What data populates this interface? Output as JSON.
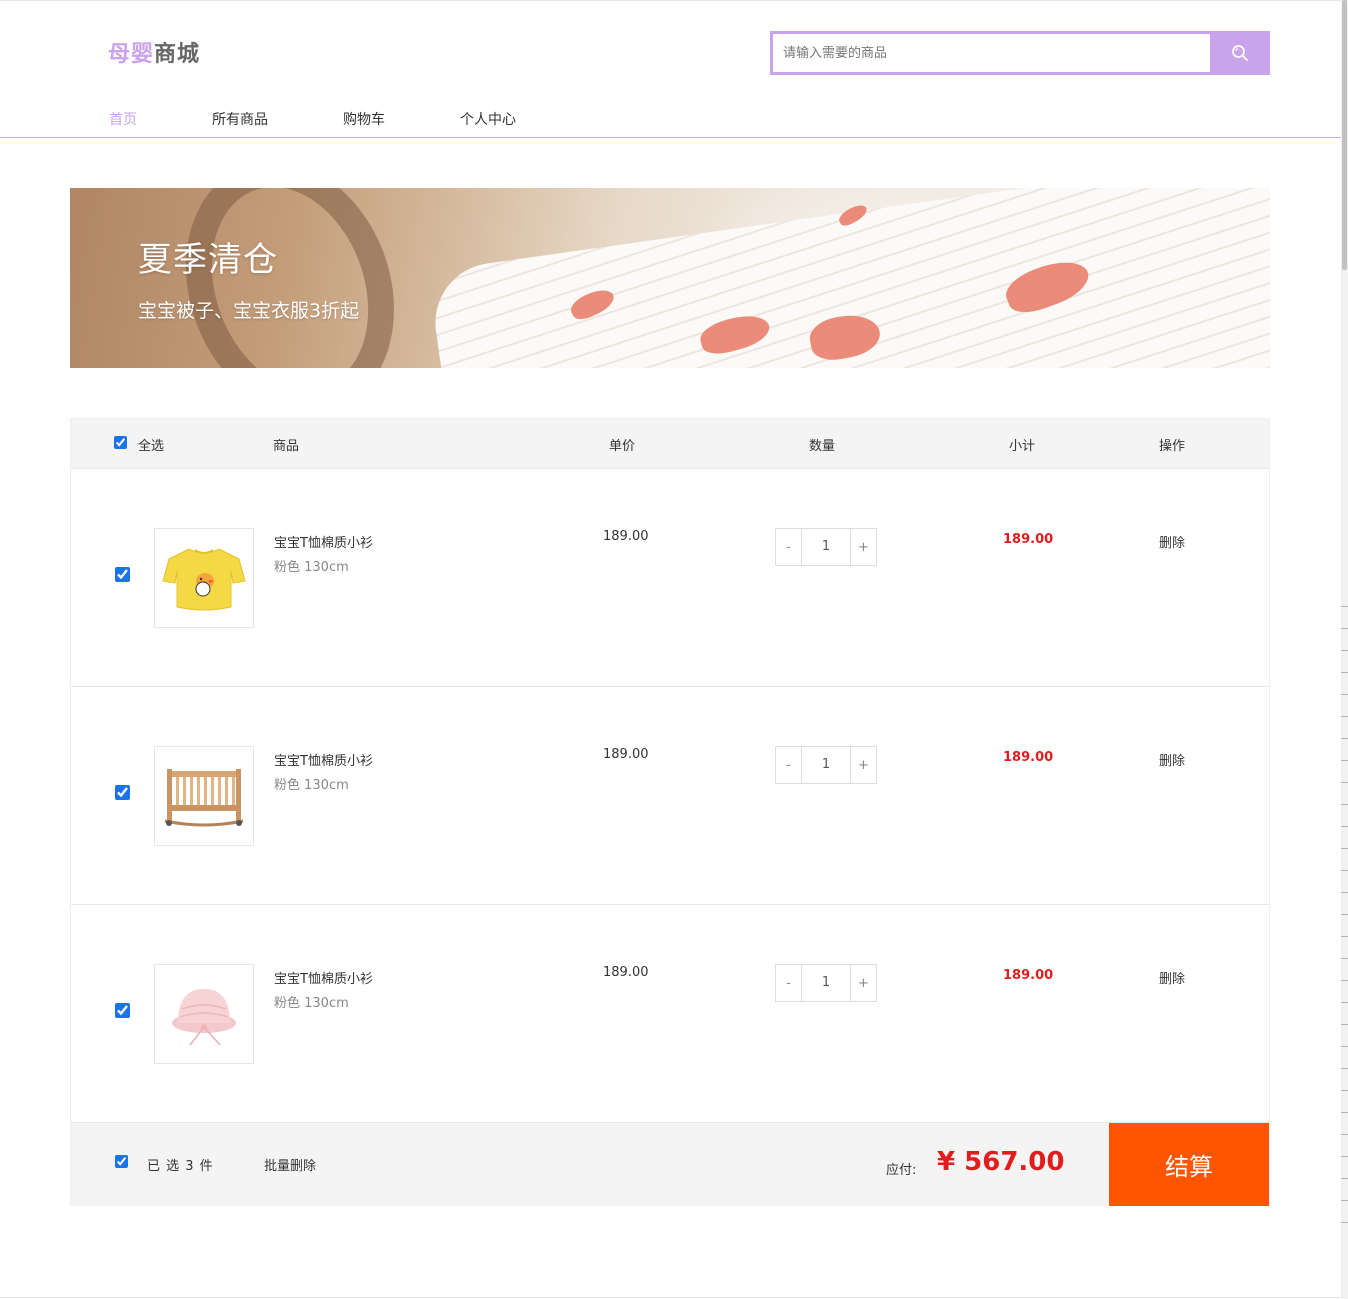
{
  "header": {
    "logo_mark": "母婴",
    "logo_text": "商城",
    "search_placeholder": "请输入需要的商品",
    "search_icon": "search-icon"
  },
  "nav": {
    "items": [
      {
        "label": "首页",
        "active": true
      },
      {
        "label": "所有商品",
        "active": false
      },
      {
        "label": "购物车",
        "active": false
      },
      {
        "label": "个人中心",
        "active": false
      }
    ]
  },
  "banner": {
    "title": "夏季清仓",
    "subtitle": "宝宝被子、宝宝衣服3折起"
  },
  "cart": {
    "columns": {
      "select_all": "全选",
      "product": "商品",
      "unit_price": "单价",
      "quantity": "数量",
      "subtotal": "小计",
      "action": "操作"
    },
    "items": [
      {
        "name": "宝宝T恤棉质小衫",
        "spec": "粉色 130cm",
        "price": "189.00",
        "minus": "-",
        "qty": "1",
        "plus": "+",
        "subtotal": "189.00",
        "delete": "删除",
        "image": "yellow-shirt-image",
        "checked": true
      },
      {
        "name": "宝宝T恤棉质小衫",
        "spec": "粉色 130cm",
        "price": "189.00",
        "minus": "-",
        "qty": "1",
        "plus": "+",
        "subtotal": "189.00",
        "delete": "删除",
        "image": "wooden-crib-image",
        "checked": true
      },
      {
        "name": "宝宝T恤棉质小衫",
        "spec": "粉色 130cm",
        "price": "189.00",
        "minus": "-",
        "qty": "1",
        "plus": "+",
        "subtotal": "189.00",
        "delete": "删除",
        "image": "pink-hat-image",
        "checked": true
      }
    ],
    "footer": {
      "selected_text": "已 选 3 件",
      "bulk_delete": "批量删除",
      "pay_label": "应付:",
      "total": "¥ 567.00",
      "checkout": "结算"
    }
  },
  "colors": {
    "accent": "#c9a3ec",
    "price_red": "#e21d1d",
    "checkout_orange": "#ff5500",
    "header_bg": "#f4f4f4"
  }
}
